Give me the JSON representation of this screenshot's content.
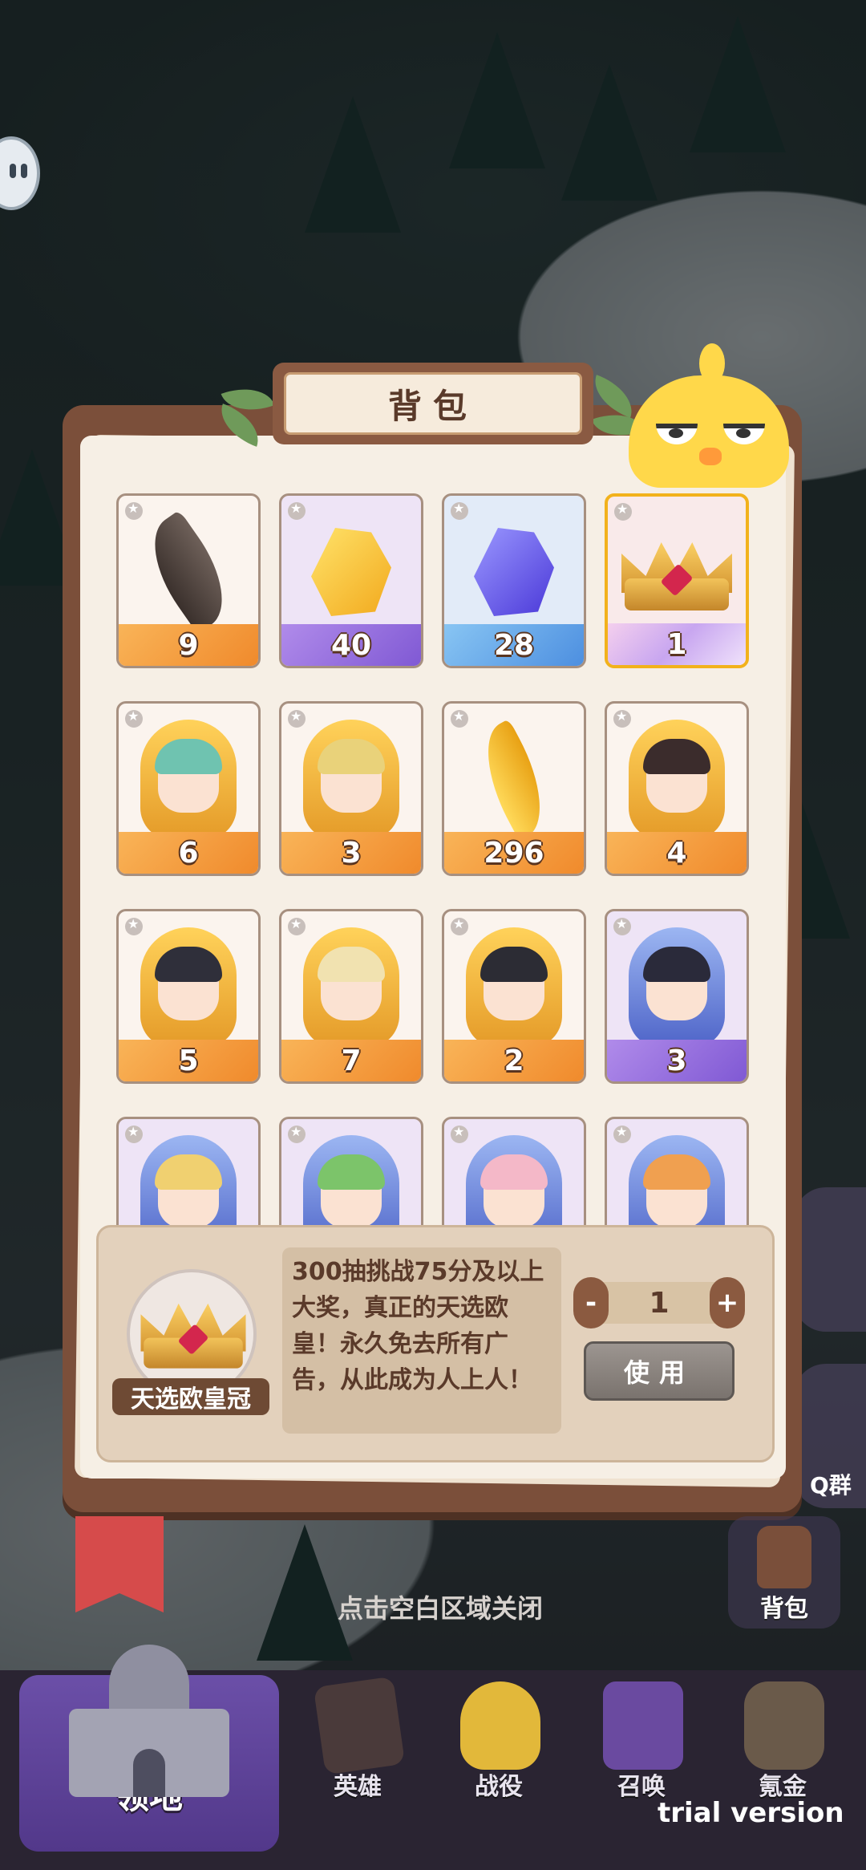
{
  "panel": {
    "title": "背包"
  },
  "items": [
    {
      "count": "9",
      "type": "grey-feather",
      "rarity": "orange"
    },
    {
      "count": "40",
      "type": "gold-gem",
      "rarity": "purple"
    },
    {
      "count": "28",
      "type": "blue-gem",
      "rarity": "blue"
    },
    {
      "count": "1",
      "type": "crown",
      "rarity": "iridescent",
      "selected": true
    },
    {
      "count": "6",
      "type": "hero-portrait",
      "rarity": "orange",
      "hair": "#6fc3b0"
    },
    {
      "count": "3",
      "type": "hero-portrait",
      "rarity": "orange",
      "hair": "#e9d27a"
    },
    {
      "count": "296",
      "type": "golden-feather",
      "rarity": "orange"
    },
    {
      "count": "4",
      "type": "hero-portrait",
      "rarity": "orange",
      "hair": "#3b2c2c"
    },
    {
      "count": "5",
      "type": "hero-portrait",
      "rarity": "orange",
      "hair": "#2f2f3a"
    },
    {
      "count": "7",
      "type": "hero-portrait",
      "rarity": "orange",
      "hair": "#f1e2b0"
    },
    {
      "count": "2",
      "type": "hero-portrait",
      "rarity": "orange",
      "hair": "#2c2c34"
    },
    {
      "count": "3",
      "type": "hero-portrait",
      "rarity": "purple",
      "hair": "#2a2a3a"
    },
    {
      "count": "",
      "type": "hero-portrait",
      "rarity": "purple",
      "hair": "#f0d070"
    },
    {
      "count": "",
      "type": "hero-portrait",
      "rarity": "purple",
      "hair": "#7cc46a"
    },
    {
      "count": "",
      "type": "hero-portrait",
      "rarity": "purple",
      "hair": "#f4b8c8"
    },
    {
      "count": "",
      "type": "hero-portrait",
      "rarity": "purple",
      "hair": "#f0a050"
    }
  ],
  "detail": {
    "name": "天选欧皇冠",
    "description": "300抽挑战75分及以上大奖，真正的天选欧皇！永久免去所有广告，从此成为人上人！",
    "quantity": "1",
    "minus_label": "-",
    "plus_label": "+",
    "use_label": "使用"
  },
  "hint": "点击空白区域关闭",
  "side": {
    "bag_label": "背包",
    "group_label": "Q群"
  },
  "nav": {
    "home": "领地",
    "heroes": "英雄",
    "battle": "战役",
    "summon": "召唤",
    "shop": "氪金"
  },
  "watermark": "trial version",
  "colors": {
    "panel_frame": "#7b4f3a",
    "selected_border": "#f2b21c",
    "nav_active": "#6b4fa8"
  }
}
